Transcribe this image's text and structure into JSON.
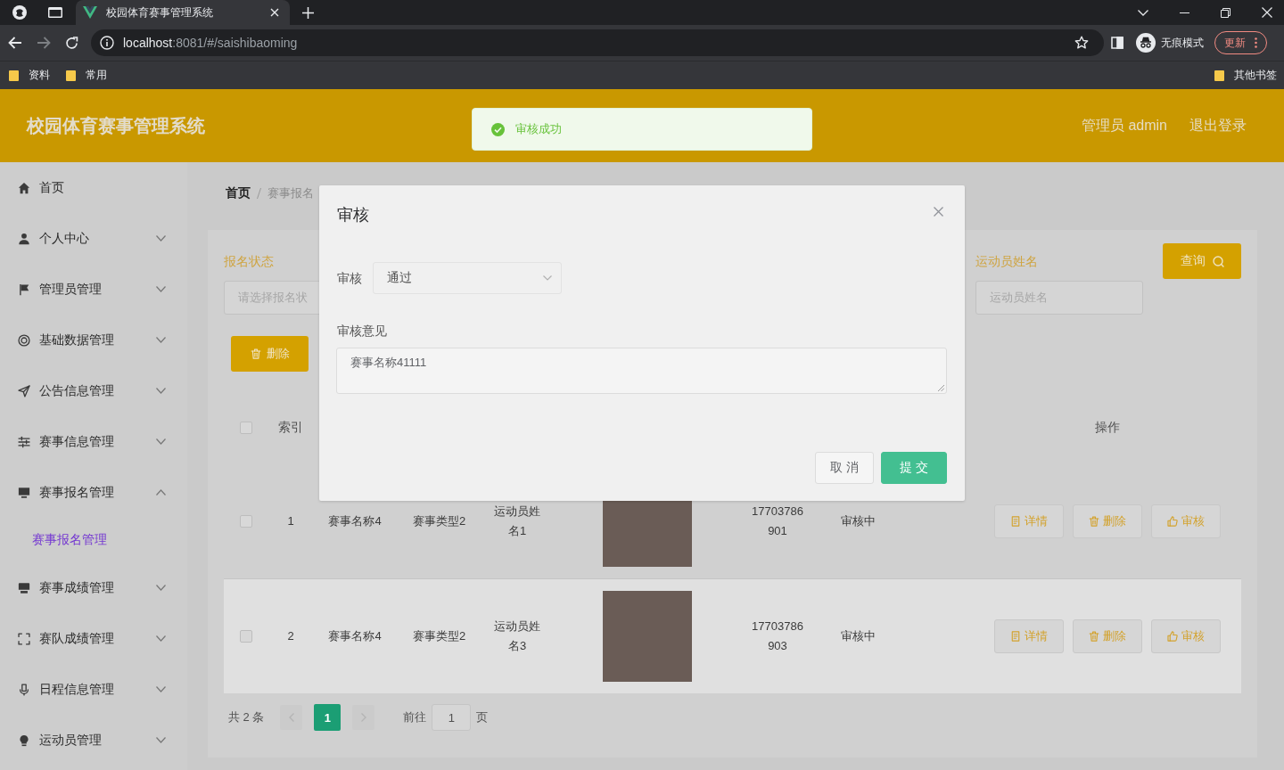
{
  "browser": {
    "tab_title": "校园体育赛事管理系统",
    "url": "localhost:8081/#/saishibaoming",
    "profile_label": "无痕模式",
    "update_button": "更新",
    "bookmarks": [
      "资料",
      "常用"
    ],
    "other_bookmarks": "其他书签"
  },
  "header": {
    "title": "校园体育赛事管理系统",
    "user": "管理员 admin",
    "logout": "退出登录"
  },
  "toast": {
    "kind": "success",
    "message": "审核成功"
  },
  "sidebar": {
    "items": [
      {
        "label": "首页",
        "kind": "link"
      },
      {
        "label": "个人中心",
        "kind": "submenu",
        "expanded": false
      },
      {
        "label": "管理员管理",
        "kind": "submenu",
        "expanded": false
      },
      {
        "label": "基础数据管理",
        "kind": "submenu",
        "expanded": false
      },
      {
        "label": "公告信息管理",
        "kind": "submenu",
        "expanded": false
      },
      {
        "label": "赛事信息管理",
        "kind": "submenu",
        "expanded": false
      },
      {
        "label": "赛事报名管理",
        "kind": "submenu",
        "expanded": true,
        "children": [
          {
            "label": "赛事报名管理",
            "selected": true
          }
        ]
      },
      {
        "label": "赛事成绩管理",
        "kind": "submenu",
        "expanded": false
      },
      {
        "label": "赛队成绩管理",
        "kind": "submenu",
        "expanded": false
      },
      {
        "label": "日程信息管理",
        "kind": "submenu",
        "expanded": false
      },
      {
        "label": "运动员管理",
        "kind": "submenu",
        "expanded": false
      }
    ]
  },
  "breadcrumb": [
    "首页",
    "赛事报名"
  ],
  "search": {
    "fields": [
      {
        "label": "报名状态",
        "placeholder": "请选择报名状"
      },
      {
        "label": "运动员姓名",
        "placeholder": "运动员姓名"
      }
    ],
    "button": "查询"
  },
  "delete_button": "删除",
  "table": {
    "select_all_checked": false,
    "index_heading": "索引",
    "actions_heading": "操作",
    "rows": [
      {
        "checked": false,
        "highlighted": false,
        "index": "1",
        "event_name": "赛事名称4",
        "event_type": "赛事类型2",
        "athlete_name": "运动员姓名1",
        "phone": "17703786901",
        "status": "审核中",
        "actions": [
          {
            "kind": "detail",
            "label": "详情"
          },
          {
            "kind": "delete",
            "label": "删除"
          },
          {
            "kind": "review",
            "label": "审核"
          }
        ]
      },
      {
        "checked": false,
        "highlighted": true,
        "index": "2",
        "event_name": "赛事名称4",
        "event_type": "赛事类型2",
        "athlete_name": "运动员姓名3",
        "phone": "17703786903",
        "status": "审核中",
        "actions": [
          {
            "kind": "detail",
            "label": "详情"
          },
          {
            "kind": "delete",
            "label": "删除"
          },
          {
            "kind": "review",
            "label": "审核"
          }
        ]
      }
    ]
  },
  "pagination": {
    "total": "共 2 条",
    "prev_disabled": true,
    "next_disabled": true,
    "pages": [
      {
        "label": "1",
        "selected": true
      }
    ],
    "goto_label": "前往",
    "goto_value": "1",
    "page_suffix": "页"
  },
  "dialog": {
    "title": "审核",
    "fields": [
      {
        "kind": "select",
        "label": "审核",
        "value": "通过"
      },
      {
        "kind": "textarea",
        "label": "审核意见",
        "value": "赛事名称41111"
      }
    ],
    "buttons": [
      {
        "kind": "secondary",
        "label": "取消"
      },
      {
        "kind": "primary",
        "label": "提交"
      }
    ]
  }
}
